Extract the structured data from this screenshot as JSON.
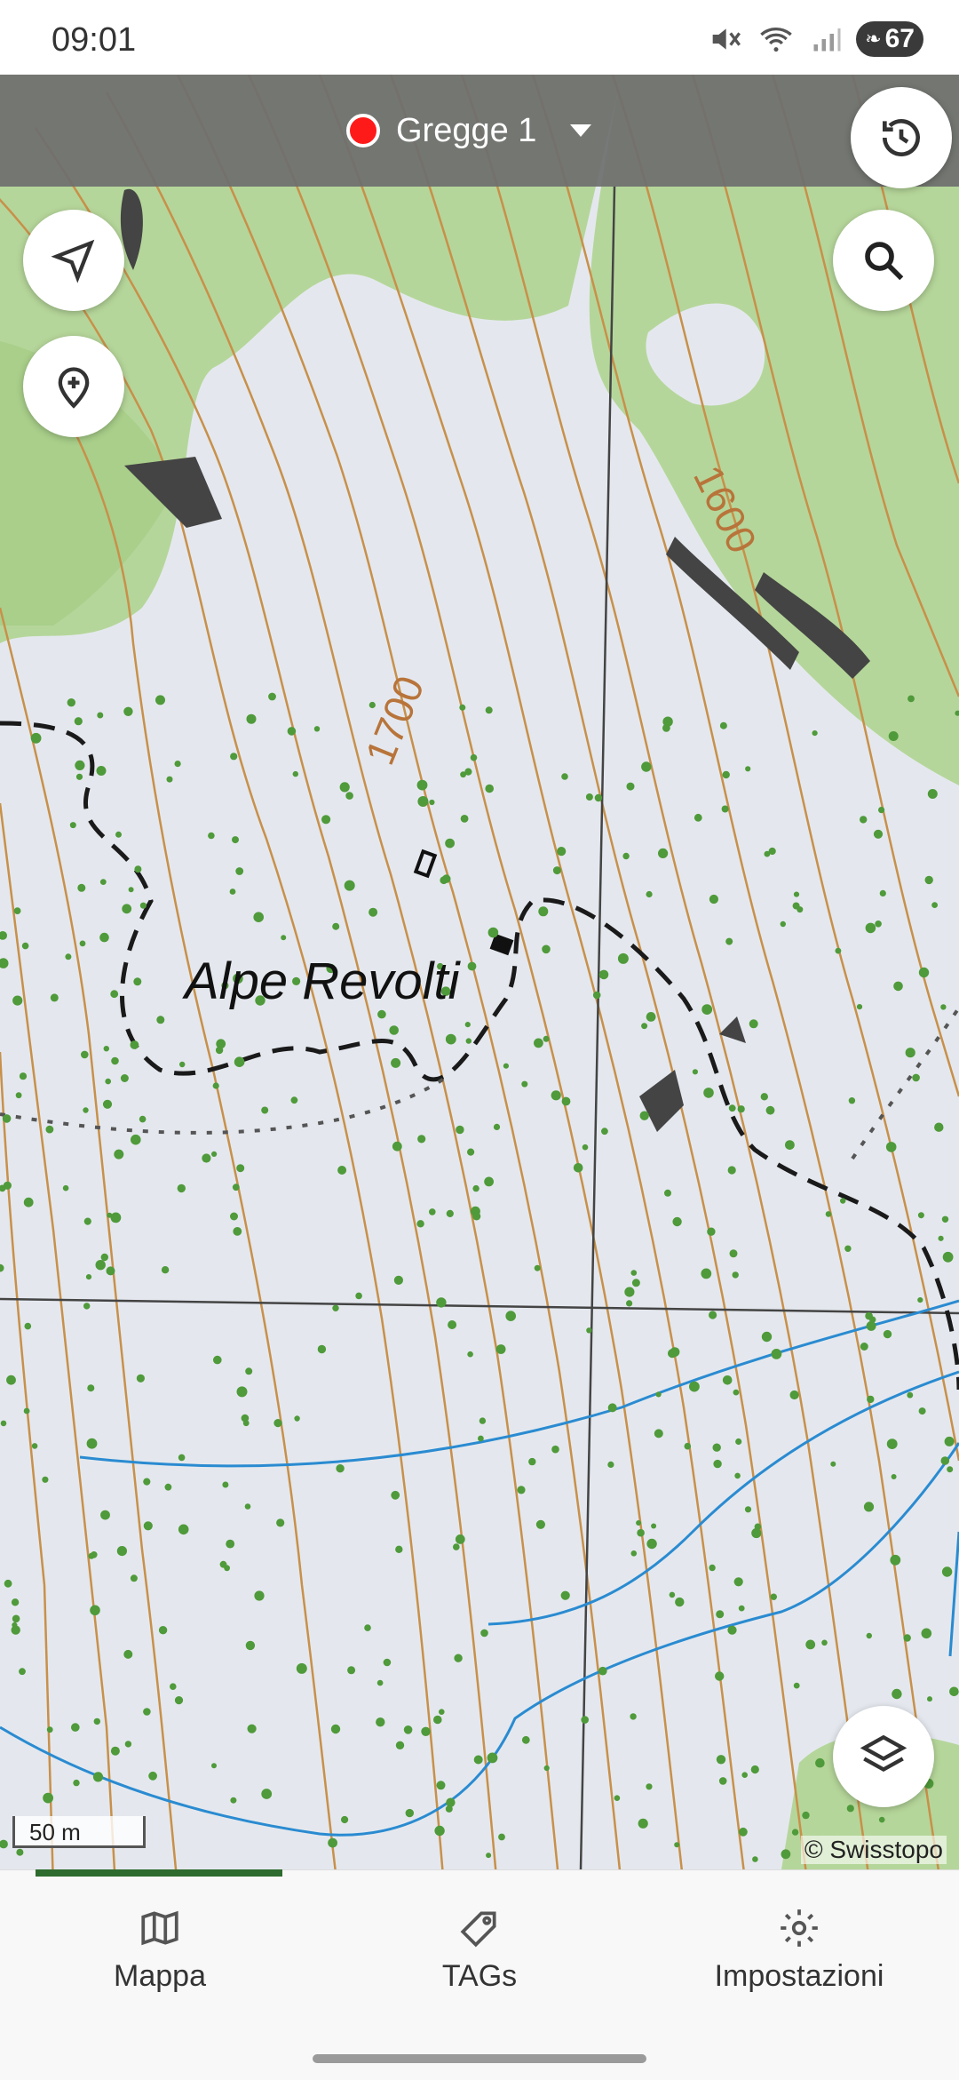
{
  "status": {
    "time": "09:01",
    "battery": "67"
  },
  "header": {
    "herd_label": "Gregge 1",
    "herd_color": "#ff1a1a"
  },
  "map": {
    "place_name": "Alpe Revolti",
    "contour_labels": [
      "1700",
      "1600"
    ],
    "scale_label": "50 m",
    "attribution": "© Swisstopo"
  },
  "icons": {
    "history": "history-icon",
    "locate": "navigation-arrow-icon",
    "add_marker": "add-location-icon",
    "search": "search-icon",
    "layers": "layers-icon"
  },
  "nav": {
    "items": [
      {
        "label": "Mappa",
        "icon": "map-icon"
      },
      {
        "label": "TAGs",
        "icon": "tag-icon"
      },
      {
        "label": "Impostazioni",
        "icon": "gear-icon"
      }
    ]
  },
  "colors": {
    "accent_green": "#2e6b2e",
    "contour": "#c8904a",
    "forest": "#a9d18e",
    "water": "#2a8bd1"
  }
}
